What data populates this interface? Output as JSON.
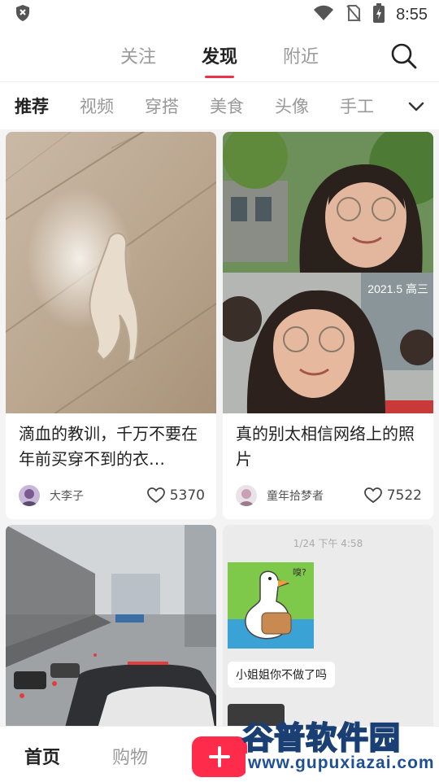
{
  "status_bar": {
    "time": "8:55",
    "icons": [
      "shield-icon",
      "wifi-icon",
      "no-sim-icon",
      "battery-charging-icon"
    ]
  },
  "top_nav": {
    "tabs": [
      {
        "label": "关注",
        "active": false
      },
      {
        "label": "发现",
        "active": true
      },
      {
        "label": "附近",
        "active": false
      }
    ],
    "search_icon": "search-icon",
    "accent_color": "#e8334a"
  },
  "categories": {
    "items": [
      "推荐",
      "视频",
      "穿搭",
      "美食",
      "头像",
      "手工"
    ],
    "active_index": 0,
    "expand_icon": "chevron-down-icon"
  },
  "feed": {
    "cards": [
      {
        "title": "滴血的教训，千万不要在年前买穿不到的衣…",
        "author": "大李子",
        "likes": "5370"
      },
      {
        "title": "真的别太相信网络上的照片",
        "author": "童年拾梦者",
        "likes": "7522",
        "image_overlay_text": "2021.5 高三"
      },
      {
        "title": "",
        "author": "",
        "likes": ""
      },
      {
        "title": "",
        "author": "",
        "likes": "",
        "chat_time": "1/24 下午 4:58",
        "chat_message": "小姐姐你不做了吗",
        "sticker_text": "嗅?"
      }
    ]
  },
  "bottom_nav": {
    "home": "首页",
    "shop": "购物",
    "add_icon": "plus-icon",
    "brand_color": "#ff2b4b"
  },
  "watermark": {
    "title": "谷普软件园",
    "url": "www.gupuxiazai.com"
  }
}
